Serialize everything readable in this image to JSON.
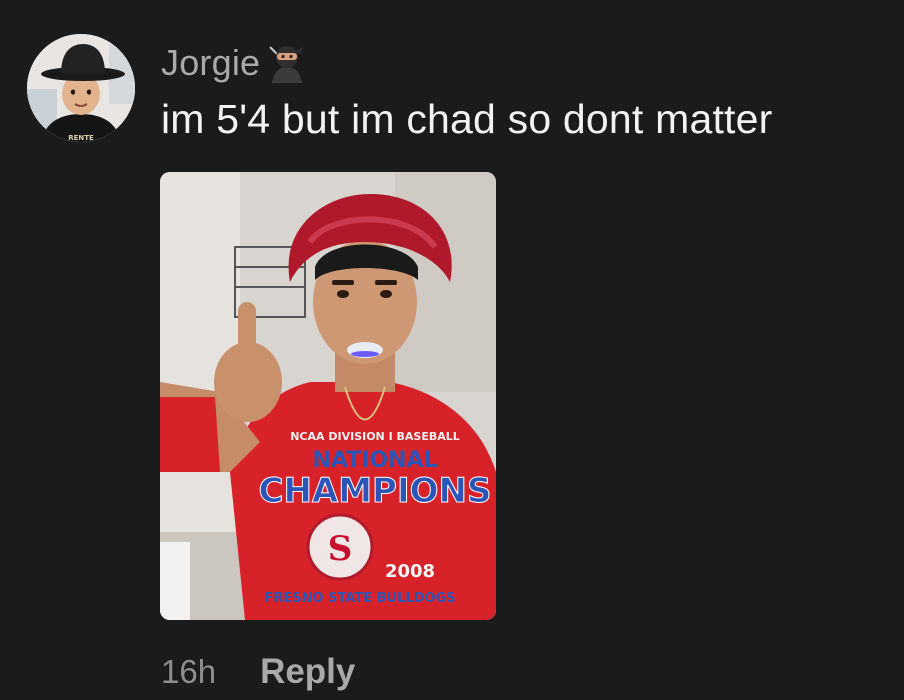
{
  "comment": {
    "username": "Jorgie",
    "username_badge_icon": "ninja-emoji-icon",
    "text": "im 5'4 but im chad so dont matter",
    "photo": {
      "shirt_line_1": "NCAA DIVISION I BASEBALL",
      "shirt_line_2": "NATIONAL",
      "shirt_line_3": "CHAMPIONS",
      "shirt_line_4": "FRESNO STATE BULLDOGS",
      "shirt_year": "2008"
    },
    "timestamp": "16h",
    "reply_label": "Reply"
  },
  "colors": {
    "background": "#1b1b1c",
    "username": "#a9a9ab",
    "text": "#f2f2f2",
    "meta": "#8e8e91"
  }
}
